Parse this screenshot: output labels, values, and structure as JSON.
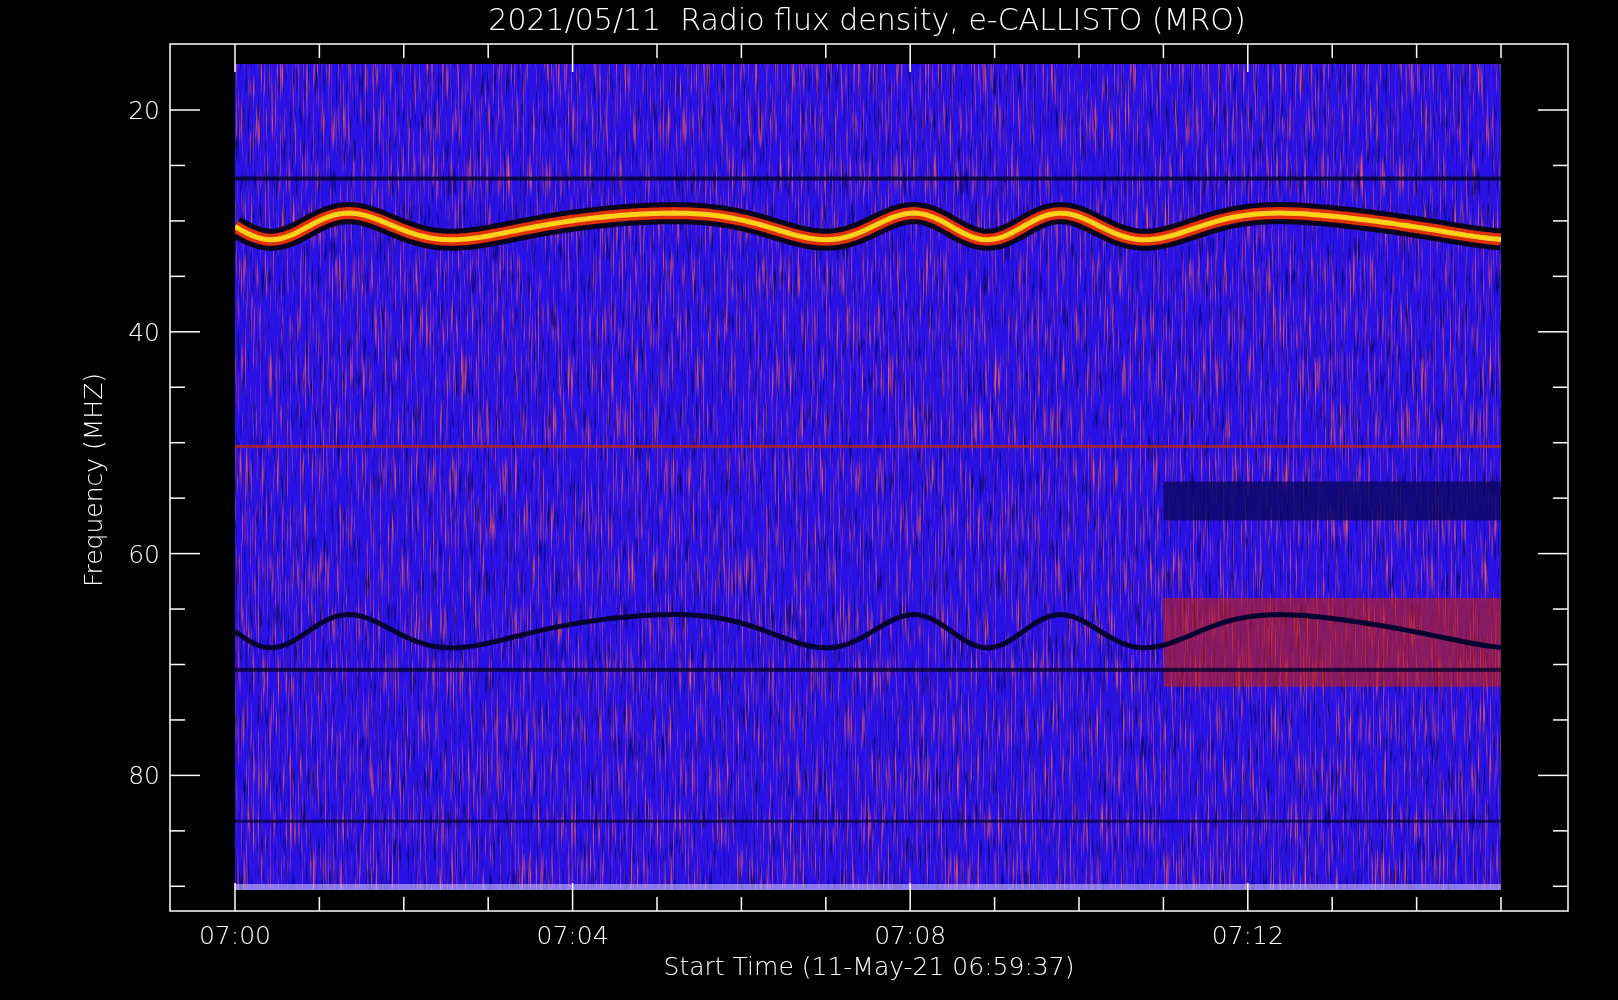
{
  "title": "2021/05/11  Radio flux density, e-CALLISTO (MRO)",
  "ylabel": "Frequency (MHZ)",
  "xlabel": "Start Time (11-May-21 06:59:37)",
  "yticks": [
    "20",
    "40",
    "60",
    "80"
  ],
  "xticks": [
    "07:00",
    "07:04",
    "07:08",
    "07:12"
  ]
}
